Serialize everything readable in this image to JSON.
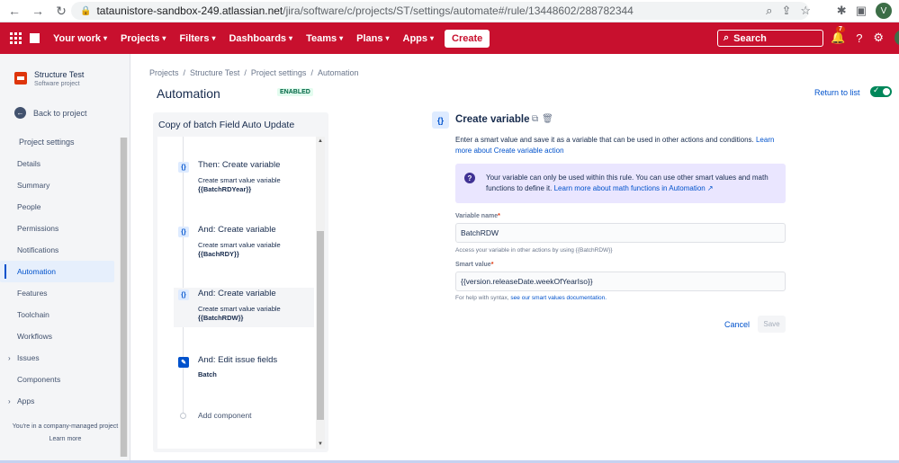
{
  "browser": {
    "url_host": "tataunistore-sandbox-249.atlassian.net",
    "url_path": "/jira/software/c/projects/ST/settings/automate#/rule/13448602/288782344",
    "profile_initial": "V"
  },
  "topnav": {
    "items": [
      {
        "label": "Your work"
      },
      {
        "label": "Projects"
      },
      {
        "label": "Filters"
      },
      {
        "label": "Dashboards"
      },
      {
        "label": "Teams"
      },
      {
        "label": "Plans"
      },
      {
        "label": "Apps"
      }
    ],
    "create_label": "Create",
    "search_placeholder": "Search",
    "notification_count": "7",
    "avatar_initial": "V",
    "bar_color": "#c8102e"
  },
  "sidebar": {
    "project_name": "Structure Test",
    "project_type": "Software project",
    "back_label": "Back to project",
    "header": "Project settings",
    "items": [
      {
        "label": "Details"
      },
      {
        "label": "Summary"
      },
      {
        "label": "People"
      },
      {
        "label": "Permissions"
      },
      {
        "label": "Notifications"
      },
      {
        "label": "Automation"
      },
      {
        "label": "Features"
      },
      {
        "label": "Toolchain"
      },
      {
        "label": "Workflows"
      },
      {
        "label": "Issues"
      },
      {
        "label": "Components"
      },
      {
        "label": "Apps"
      }
    ],
    "footer_text": "You're in a company-managed project",
    "footer_link": "Learn more"
  },
  "breadcrumb": [
    "Projects",
    "Structure Test",
    "Project settings",
    "Automation"
  ],
  "page": {
    "title": "Automation",
    "status_badge": "ENABLED",
    "return_link": "Return to list"
  },
  "rule": {
    "name": "Copy of batch Field Auto Update",
    "steps": [
      {
        "icon": "{}",
        "title": "Then: Create variable",
        "desc": "Create smart value variable",
        "value": "{{BatchRDYear}}"
      },
      {
        "icon": "{}",
        "title": "And: Create variable",
        "desc": "Create smart value variable",
        "value": "{{BachRDY}}"
      },
      {
        "icon": "{}",
        "title": "And: Create variable",
        "desc": "Create smart value variable",
        "value": "{{BatchRDW}}"
      },
      {
        "icon": "✎",
        "title": "And: Edit issue fields",
        "desc": "",
        "value": "Batch"
      }
    ],
    "add_component": "Add component"
  },
  "detail": {
    "icon": "{}",
    "title": "Create variable",
    "desc_text": "Enter a smart value and save it as a variable that can be used in other actions and conditions. ",
    "desc_link": "Learn more about Create variable action",
    "info_text": "Your variable can only be used within this rule. You can use other smart values and math functions to define it. ",
    "info_link": "Learn more about math functions in Automation ↗",
    "variable_name_label": "Variable name",
    "variable_name_value": "BatchRDW",
    "variable_name_help": "Access your variable in other actions by using {{BatchRDW}}",
    "smart_value_label": "Smart value",
    "smart_value_value": "{{version.releaseDate.weekOfYearIso}}",
    "smart_value_help": "For help with syntax, ",
    "smart_value_help_link": "see our smart values documentation.",
    "cancel_label": "Cancel",
    "save_label": "Save"
  }
}
